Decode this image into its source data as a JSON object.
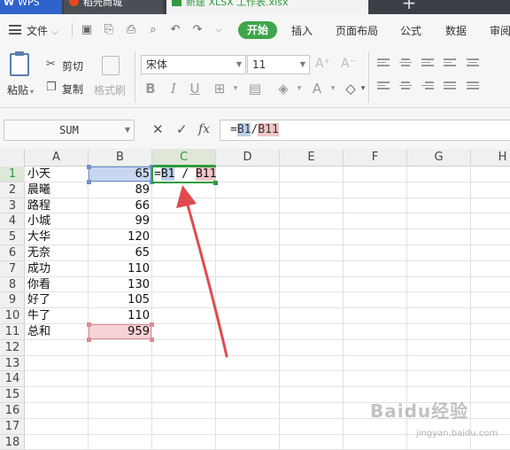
{
  "window_tabs": {
    "wps": "WPS",
    "store": "稻壳商城",
    "document": "新建 XLSX 工作表.xlsx",
    "add": "+"
  },
  "menubar": {
    "file": "文件",
    "start": "开始",
    "items": [
      "插入",
      "页面布局",
      "公式",
      "数据",
      "审阅"
    ]
  },
  "ribbon": {
    "cut": "剪切",
    "copy": "复制",
    "paste": "粘贴",
    "format_painter": "格式刷",
    "font_name": "宋体",
    "font_size": "11",
    "bold": "B",
    "italic": "I",
    "underline": "U",
    "font_grow": "A⁺",
    "font_shrink": "A⁻"
  },
  "formula_bar": {
    "name_box": "SUM",
    "cancel": "✕",
    "confirm": "✓",
    "fx": "fx",
    "formula_prefix": "=",
    "ref_b1": "B1",
    "slash": "/",
    "ref_b11": "B11"
  },
  "sheet": {
    "columns": [
      "A",
      "B",
      "C",
      "D",
      "E",
      "F",
      "G",
      "H"
    ],
    "rows": [
      "1",
      "2",
      "3",
      "4",
      "5",
      "6",
      "7",
      "8",
      "9",
      "10",
      "11",
      "12",
      "13",
      "14",
      "15",
      "16",
      "17",
      "18"
    ],
    "names": [
      "小天",
      "晨曦",
      "路程",
      "小城",
      "大华",
      "无奈",
      "成功",
      "你看",
      "好了",
      "牛了",
      "总和"
    ],
    "values": [
      "65",
      "89",
      "66",
      "99",
      "120",
      "65",
      "110",
      "130",
      "105",
      "110",
      "959"
    ],
    "active_cell_content": {
      "prefix": "=",
      "ref_b1": "B1",
      "slash": " / ",
      "ref_b11": "B11"
    }
  },
  "colors": {
    "accent_green": "#2f9a3f",
    "ref_blue": "#c8d6ef",
    "ref_red": "#f6d3d5",
    "arrow_red": "#e04a4f"
  },
  "watermark": {
    "brand": "Baidu经验",
    "url": "jingyan.baidu.com"
  }
}
